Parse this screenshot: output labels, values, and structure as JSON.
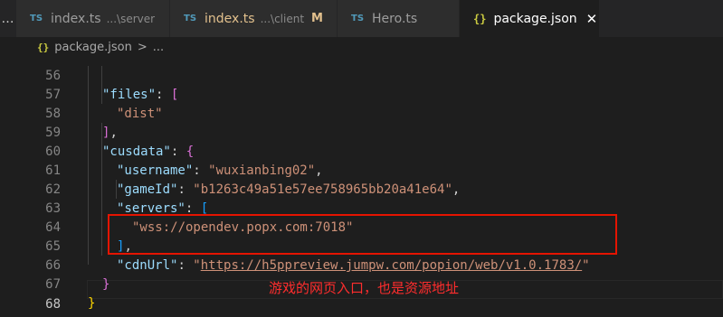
{
  "tabbar": {
    "overflow_glyph": "…",
    "tabs": [
      {
        "icon": "TS",
        "label": "index.ts",
        "desc": "...\\server",
        "status": ""
      },
      {
        "icon": "TS",
        "label": "index.ts",
        "desc": "...\\client",
        "status": "M"
      },
      {
        "icon": "TS",
        "label": "Hero.ts",
        "desc": "",
        "status": ""
      },
      {
        "icon": "{}",
        "label": "package.json",
        "desc": "",
        "status": "",
        "close": "✕"
      }
    ]
  },
  "breadcrumb": {
    "icon": "{}",
    "file": "package.json",
    "separator": ">",
    "more": "..."
  },
  "editor": {
    "line_numbers": [
      "56",
      "57",
      "58",
      "59",
      "60",
      "61",
      "62",
      "63",
      "64",
      "65",
      "66",
      "67",
      "68"
    ],
    "lines": {
      "l56": {
        "key": "\"files\"",
        "colon": ": ",
        "bracket": "["
      },
      "l57": {
        "str": "\"dist\""
      },
      "l58": {
        "bracket": "]",
        "comma": ","
      },
      "l59": {
        "key": "\"cusdata\"",
        "colon": ": ",
        "brace": "{"
      },
      "l60": {
        "key": "\"username\"",
        "colon": ": ",
        "str": "\"wuxianbing02\"",
        "comma": ","
      },
      "l61": {
        "key": "\"gameId\"",
        "colon": ": ",
        "str": "\"b1263c49a51e57ee758965bb20a41e64\"",
        "comma": ","
      },
      "l62": {
        "key": "\"servers\"",
        "colon": ": ",
        "bracket": "["
      },
      "l63": {
        "str": "\"wss://opendev.popx.com:7018\""
      },
      "l64": {
        "bracket": "]",
        "comma": ","
      },
      "l65": {
        "key": "\"cdnUrl\"",
        "colon": ": ",
        "q1": "\"",
        "url": "https://h5ppreview.jumpw.com/popion/web/v1.0.1783/",
        "q2": "\""
      },
      "l66": {
        "brace": "}"
      },
      "l67": {
        "brace": "}"
      }
    }
  },
  "annotation": {
    "text": "游戏的网页入口，也是资源地址",
    "color": "#ff2d2d"
  },
  "colors": {
    "background": "#1e1e1e",
    "key": "#9cdcfe",
    "string": "#ce9178",
    "bracket_gold": "#ffd700",
    "bracket_purple": "#da70d6",
    "bracket_blue": "#179fff",
    "highlight_border": "#e51400"
  }
}
